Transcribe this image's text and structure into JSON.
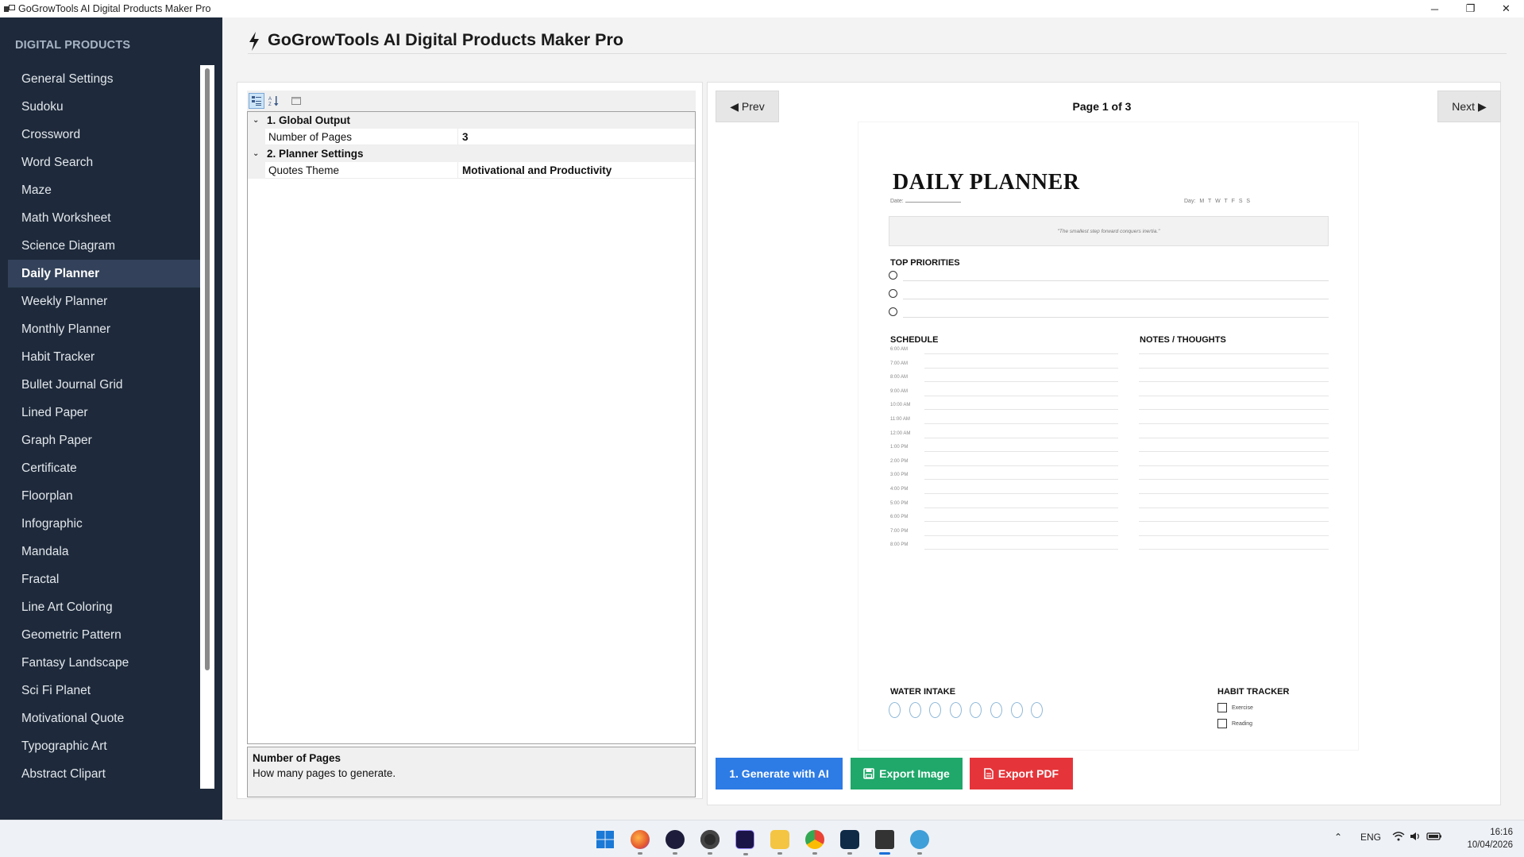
{
  "window": {
    "title": "GoGrowTools AI Digital Products Maker Pro",
    "minimize": "─",
    "maximize": "❐",
    "close": "✕"
  },
  "sidebar": {
    "heading": "DIGITAL PRODUCTS",
    "items": [
      {
        "label": "General Settings"
      },
      {
        "label": "Sudoku"
      },
      {
        "label": "Crossword"
      },
      {
        "label": "Word Search"
      },
      {
        "label": "Maze"
      },
      {
        "label": "Math Worksheet"
      },
      {
        "label": "Science Diagram"
      },
      {
        "label": "Daily Planner",
        "active": true
      },
      {
        "label": "Weekly Planner"
      },
      {
        "label": "Monthly Planner"
      },
      {
        "label": "Habit Tracker"
      },
      {
        "label": "Bullet Journal Grid"
      },
      {
        "label": "Lined Paper"
      },
      {
        "label": "Graph Paper"
      },
      {
        "label": "Certificate"
      },
      {
        "label": "Floorplan"
      },
      {
        "label": "Infographic"
      },
      {
        "label": "Mandala"
      },
      {
        "label": "Fractal"
      },
      {
        "label": "Line Art Coloring"
      },
      {
        "label": "Geometric Pattern"
      },
      {
        "label": "Fantasy Landscape"
      },
      {
        "label": "Sci Fi Planet"
      },
      {
        "label": "Motivational Quote"
      },
      {
        "label": "Typographic Art"
      },
      {
        "label": "Abstract Clipart"
      }
    ]
  },
  "header": {
    "title": "GoGrowTools AI Digital Products Maker Pro",
    "icon": "bolt-icon"
  },
  "properties": {
    "categories": [
      {
        "label": "1. Global Output",
        "rows": [
          {
            "name": "Number of Pages",
            "value": "3"
          }
        ]
      },
      {
        "label": "2. Planner Settings",
        "rows": [
          {
            "name": "Quotes Theme",
            "value": "Motivational and Productivity"
          }
        ]
      }
    ],
    "description": {
      "title": "Number of Pages",
      "text": "How many pages to generate."
    }
  },
  "preview": {
    "prev_label": "◀ Prev",
    "next_label": "Next ▶",
    "page_indicator": "Page 1 of 3",
    "planner": {
      "title": "DAILY PLANNER",
      "date_label": "Date:",
      "day_label": "Day: M  T  W  T  F  S  S",
      "quote": "\"The smallest step forward conquers inertia.\"",
      "priorities_heading": "TOP PRIORITIES",
      "schedule_heading": "SCHEDULE",
      "notes_heading": "NOTES / THOUGHTS",
      "times": [
        "6:00 AM",
        "7:00 AM",
        "8:00 AM",
        "9:00 AM",
        "10:00 AM",
        "11:00 AM",
        "12:00 AM",
        "1:00 PM",
        "2:00 PM",
        "3:00 PM",
        "4:00 PM",
        "5:00 PM",
        "6:00 PM",
        "7:00 PM",
        "8:00 PM"
      ],
      "water_heading": "WATER INTAKE",
      "water_count": 8,
      "habit_heading": "HABIT TRACKER",
      "habits": [
        "Exercise",
        "Reading"
      ]
    },
    "buttons": {
      "generate": "1. Generate with AI",
      "export_image": "Export Image",
      "export_pdf": "Export PDF"
    }
  },
  "colors": {
    "sidebar_bg": "#1e2a3b",
    "sidebar_active": "#33425a",
    "generate": "#2d7be5",
    "export_image": "#1fa86a",
    "export_pdf": "#e5353a"
  },
  "taskbar": {
    "language": "ENG",
    "time": "16:16",
    "date": "10/04/2026"
  }
}
